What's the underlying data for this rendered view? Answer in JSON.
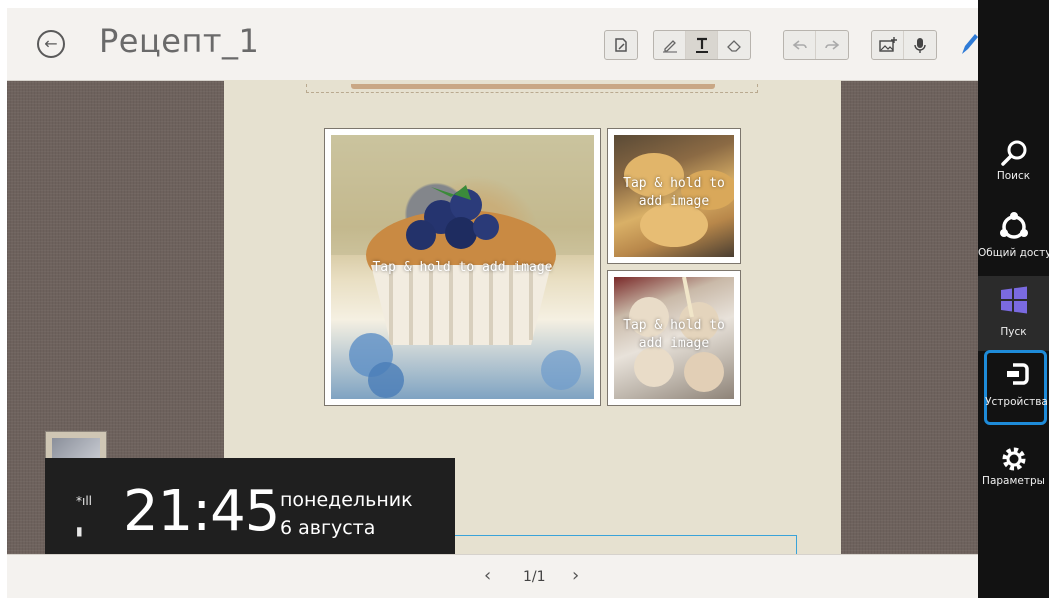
{
  "title": "Рецепт_1",
  "toolbar": {
    "items": [
      "page-template-icon",
      "pen-icon",
      "text-icon",
      "eraser-icon",
      "undo-icon",
      "redo-icon",
      "insert-image-icon",
      "microphone-icon",
      "pencil-icon"
    ]
  },
  "photos": {
    "placeholder_large": "Tap & hold to add image",
    "placeholder_small_line1": "Tap & hold to",
    "placeholder_small_line2": "add image"
  },
  "clock": {
    "time": "21:45",
    "weekday": "понедельник",
    "date": "6 августа",
    "signal_icon": "*ıll",
    "battery_icon": "▮"
  },
  "pager": {
    "prev": "‹",
    "current": "1/1",
    "next": "›"
  },
  "charms": [
    {
      "label": "Поиск",
      "icon": "search-icon"
    },
    {
      "label": "Общий доступ",
      "icon": "share-icon"
    },
    {
      "label": "Пуск",
      "icon": "windows-icon"
    },
    {
      "label": "Устройства",
      "icon": "devices-icon"
    },
    {
      "label": "Параметры",
      "icon": "gear-icon"
    }
  ]
}
